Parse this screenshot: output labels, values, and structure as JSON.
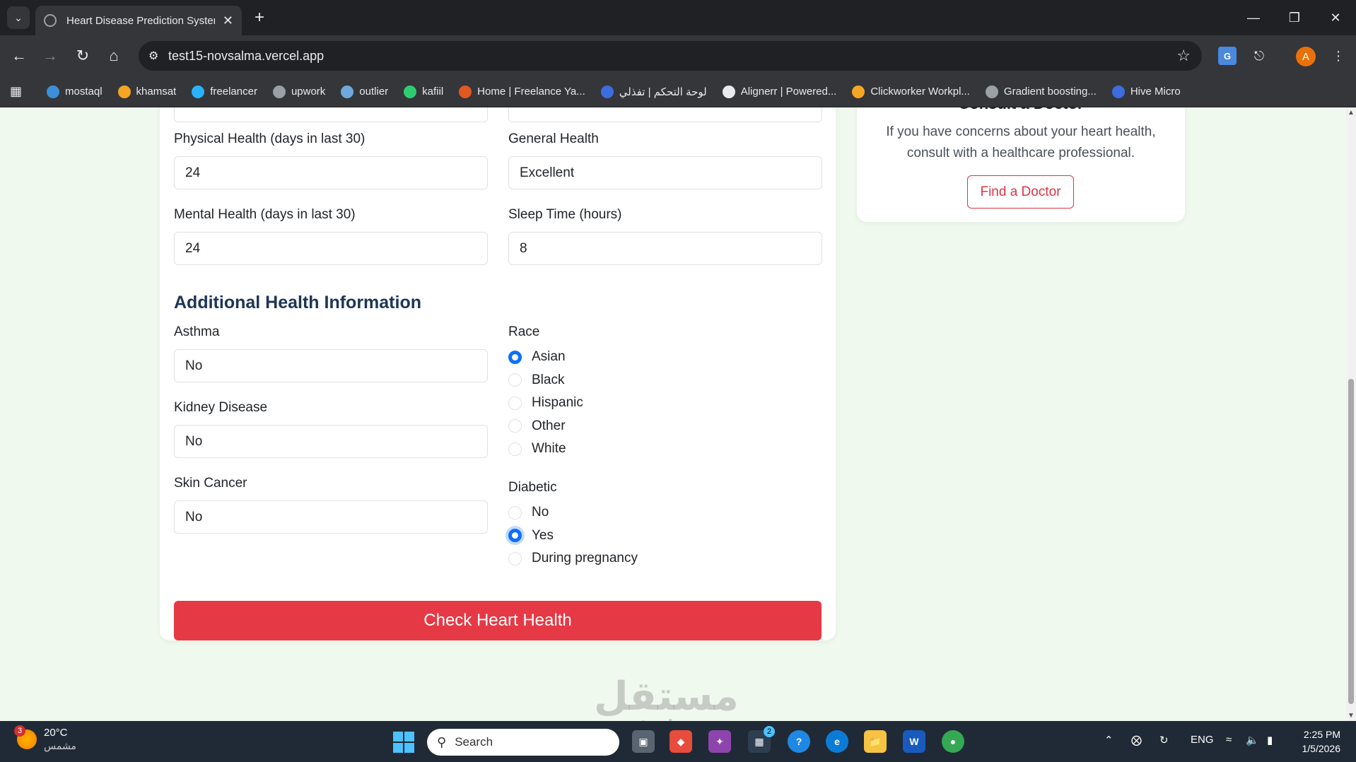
{
  "browser": {
    "tab_title": "Heart Disease Prediction System",
    "url": "test15-novsalma.vercel.app",
    "bookmarks": [
      {
        "label": "mostaql",
        "color": "#3d8fd9"
      },
      {
        "label": "khamsat",
        "color": "#f5a623"
      },
      {
        "label": "freelancer",
        "color": "#29b2fe"
      },
      {
        "label": "upwork",
        "color": "#9aa0a6"
      },
      {
        "label": "outlier",
        "color": "#6fa8dc"
      },
      {
        "label": "kafiil",
        "color": "#2ecc71"
      },
      {
        "label": "Home | Freelance Ya...",
        "color": "#e25822"
      },
      {
        "label": "لوحة التحكم | تفذلي",
        "color": "#3d6ce0"
      },
      {
        "label": "Alignerr | Powered...",
        "color": "#e8eaed"
      },
      {
        "label": "Clickworker Workpl...",
        "color": "#f5a623"
      },
      {
        "label": "Gradient boosting...",
        "color": "#9aa0a6"
      },
      {
        "label": "Hive Micro",
        "color": "#3d6ce0"
      }
    ],
    "avatar_letter": "A"
  },
  "form": {
    "physical_health": {
      "label": "Physical Health (days in last 30)",
      "value": "24"
    },
    "general_health": {
      "label": "General Health",
      "value": "Excellent"
    },
    "mental_health": {
      "label": "Mental Health (days in last 30)",
      "value": "24"
    },
    "sleep_time": {
      "label": "Sleep Time (hours)",
      "value": "8"
    },
    "section_title": "Additional Health Information",
    "asthma": {
      "label": "Asthma",
      "value": "No"
    },
    "kidney_disease": {
      "label": "Kidney Disease",
      "value": "No"
    },
    "skin_cancer": {
      "label": "Skin Cancer",
      "value": "No"
    },
    "race": {
      "label": "Race",
      "options": [
        "Asian",
        "Black",
        "Hispanic",
        "Other",
        "White"
      ],
      "selected": "Asian"
    },
    "diabetic": {
      "label": "Diabetic",
      "options": [
        "No",
        "Yes",
        "During pregnancy"
      ],
      "selected": "Yes"
    },
    "submit_label": "Check Heart Health"
  },
  "sidebar": {
    "title": "Consult a Doctor",
    "text": "If you have concerns about your heart health, consult with a healthcare professional.",
    "button_label": "Find a Doctor"
  },
  "watermark": {
    "main": "مستقل",
    "sub": "mostaql.com"
  },
  "taskbar": {
    "weather_temp": "20°C",
    "weather_desc": "مشمس",
    "weather_badge": "3",
    "search_placeholder": "Search",
    "store_badge": "2",
    "language": "ENG",
    "time": "2:25 PM",
    "date": "1/5/2026"
  },
  "colors": {
    "page_bg": "#f0f9ee",
    "accent_red": "#e63946",
    "section_title": "#1d3557",
    "radio_selected": "#0d6efd"
  }
}
